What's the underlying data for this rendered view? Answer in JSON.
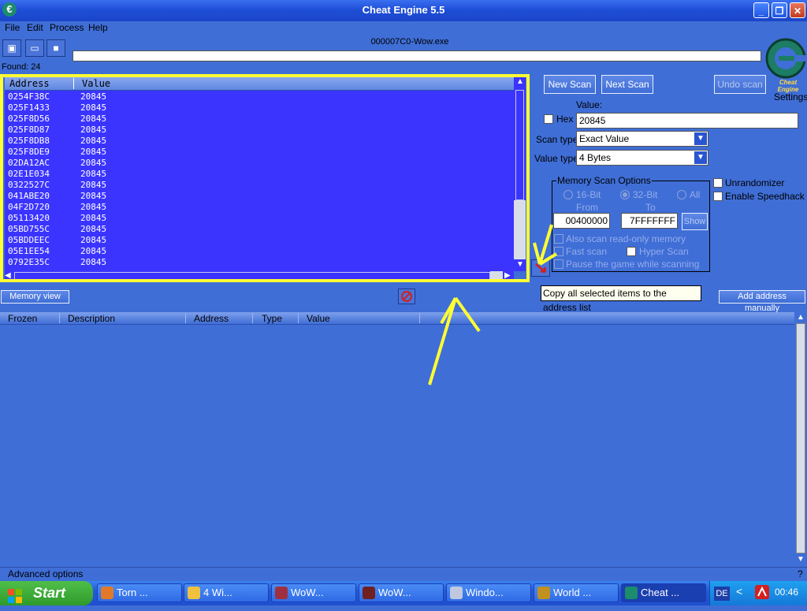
{
  "window": {
    "title": "Cheat Engine 5.5",
    "icon_glyph": "€",
    "controls": {
      "minimize": "_",
      "maximize": "❐",
      "close": "✕"
    }
  },
  "menu": [
    "File",
    "Edit",
    "Process",
    "Help"
  ],
  "toolbar": {
    "process_label": "000007C0-Wow.exe",
    "found_label": "Found: 24"
  },
  "found_list": {
    "headers": [
      "Address",
      "Value"
    ],
    "rows": [
      [
        "0254F38C",
        "20845"
      ],
      [
        "025F1433",
        "20845"
      ],
      [
        "025F8D56",
        "20845"
      ],
      [
        "025F8D87",
        "20845"
      ],
      [
        "025F8DB8",
        "20845"
      ],
      [
        "025F8DE9",
        "20845"
      ],
      [
        "02DA12AC",
        "20845"
      ],
      [
        "02E1E034",
        "20845"
      ],
      [
        "0322527C",
        "20845"
      ],
      [
        "041ABE20",
        "20845"
      ],
      [
        "04F2D720",
        "20845"
      ],
      [
        "05113420",
        "20845"
      ],
      [
        "05BD755C",
        "20845"
      ],
      [
        "05BDDEEC",
        "20845"
      ],
      [
        "05E1EE54",
        "20845"
      ],
      [
        "0792E35C",
        "20845"
      ]
    ]
  },
  "scan": {
    "new_scan": "New Scan",
    "next_scan": "Next Scan",
    "undo_scan": "Undo scan",
    "settings": "Settings",
    "logo_text": "Cheat Engine",
    "value_label": "Value:",
    "hex_label": "Hex",
    "value": "20845",
    "scan_type_label": "Scan type",
    "scan_type_value": "Exact Value",
    "value_type_label": "Value type",
    "value_type_value": "4 Bytes"
  },
  "memory_scan_options": {
    "title": "Memory Scan Options",
    "radio_16": "16-Bit",
    "radio_32": "32-Bit",
    "radio_all": "All",
    "from_label": "From",
    "to_label": "To",
    "from_value": "00400000",
    "to_value": "7FFFFFFF",
    "show_button": "Show",
    "also_scan_readonly": "Also scan read-only memory",
    "fast_scan": "Fast scan",
    "hyper_scan": "Hyper Scan",
    "pause_game": "Pause the game while scanning"
  },
  "options": {
    "unrandomizer": "Unrandomizer",
    "speedhack": "Enable Speedhack"
  },
  "tooltip": "Copy all selected items to the address list",
  "memory_view_button": "Memory view",
  "add_address_button": "Add address manually",
  "address_list": {
    "headers": [
      "Frozen",
      "Description",
      "Address",
      "Type",
      "Value"
    ]
  },
  "status": {
    "advanced_options": "Advanced options",
    "help": "?"
  },
  "taskbar": {
    "start": "Start",
    "tasks": [
      {
        "label": "Torn ...",
        "color": "#e07a2a"
      },
      {
        "label": "4 Wi...",
        "color": "#f0c040"
      },
      {
        "label": "WoW...",
        "color": "#a03040"
      },
      {
        "label": "WoW...",
        "color": "#702020"
      },
      {
        "label": "Windo...",
        "color": "#c0c8e0"
      },
      {
        "label": "World ...",
        "color": "#c09020"
      },
      {
        "label": "Cheat ...",
        "color": "#1c8c6c"
      }
    ],
    "lang": "DE",
    "clock": "00:46"
  },
  "colors": {
    "highlight": "#ffff33",
    "list_bg": "#3b34ff",
    "window_bg": "#3f6ed6"
  }
}
